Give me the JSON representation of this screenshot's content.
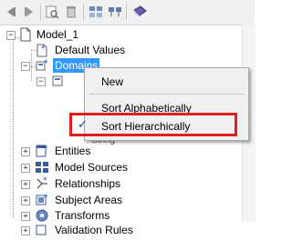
{
  "toolbar": {
    "buttons": [
      "nav-back-icon",
      "nav-forward-icon",
      "find-icon",
      "delete-icon",
      "model-compare-icon",
      "model-edit-icon",
      "book-icon"
    ]
  },
  "tree": {
    "root": "Model_1",
    "items": [
      {
        "label": "Default Values",
        "icon": "default-values-icon"
      },
      {
        "label": "Domains",
        "icon": "domains-icon",
        "selected": true
      },
      {
        "label": "String",
        "icon": "domain-item-icon"
      },
      {
        "label": "Entities",
        "icon": "entities-icon"
      },
      {
        "label": "Model Sources",
        "icon": "model-sources-icon"
      },
      {
        "label": "Relationships",
        "icon": "relationships-icon"
      },
      {
        "label": "Subject Areas",
        "icon": "subject-areas-icon"
      },
      {
        "label": "Transforms",
        "icon": "transforms-icon"
      },
      {
        "label": "Validation Rules",
        "icon": "validation-rules-icon"
      }
    ]
  },
  "context_menu": {
    "items": [
      {
        "label": "New"
      },
      {
        "label": "Sort Alphabetically"
      },
      {
        "label": "Sort Hierarchically",
        "checked": true
      }
    ],
    "check_glyph": "✓"
  },
  "colors": {
    "selection": "#3399ff",
    "highlight_box": "#e02020",
    "check": "#1a3fd1"
  }
}
